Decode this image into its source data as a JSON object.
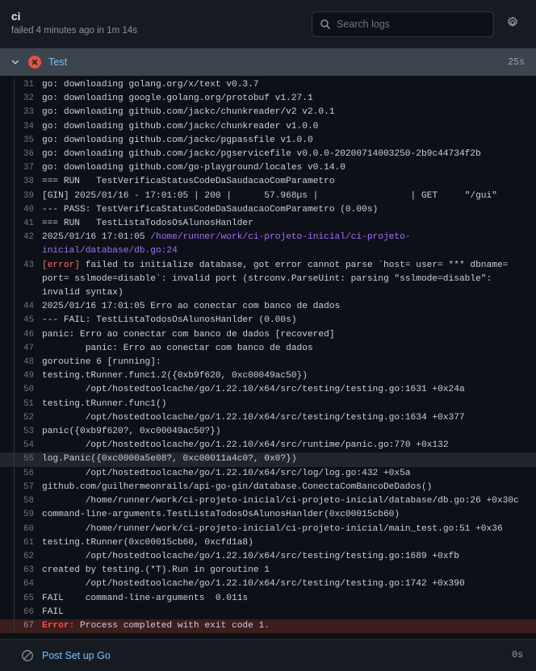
{
  "header": {
    "job_title": "ci",
    "job_status_text": "failed 4 minutes ago in 1m 14s",
    "search_placeholder": "Search logs",
    "search_value": "",
    "search_icon": "search-icon",
    "settings_icon": "gear-icon"
  },
  "step": {
    "name": "Test",
    "duration": "25s",
    "status": "failure",
    "status_icon": "x-circle-icon",
    "chevron_icon": "chevron-down-icon",
    "expanded": true
  },
  "footer_step": {
    "name": "Post Set up Go",
    "duration": "0s",
    "status": "skipped",
    "status_icon": "skip-circle-slash-icon"
  },
  "colors": {
    "page_bg": "#0d1117",
    "header_bg": "#161b22",
    "step_header_bg": "#3c444d",
    "link_blue": "#79c0ff",
    "text": "#c9d1d9",
    "muted": "#8b949e",
    "line_number": "#6e7681",
    "error_red": "#ff6b6b",
    "error_bold_red": "#f85149",
    "error_row_bg": "#3d1d1d",
    "hover_row_bg": "#21262d",
    "path_purple": "#a371f7",
    "fail_icon_bg": "#e5534b"
  },
  "log": {
    "first_line_number": 31,
    "hovered_line": 55,
    "error_line": 67,
    "lines": [
      {
        "n": 31,
        "segments": [
          {
            "t": "go: downloading golang.org/x/text v0.3.7"
          }
        ]
      },
      {
        "n": 32,
        "segments": [
          {
            "t": "go: downloading google.golang.org/protobuf v1.27.1"
          }
        ]
      },
      {
        "n": 33,
        "segments": [
          {
            "t": "go: downloading github.com/jackc/chunkreader/v2 v2.0.1"
          }
        ]
      },
      {
        "n": 34,
        "segments": [
          {
            "t": "go: downloading github.com/jackc/chunkreader v1.0.0"
          }
        ]
      },
      {
        "n": 35,
        "segments": [
          {
            "t": "go: downloading github.com/jackc/pgpassfile v1.0.0"
          }
        ]
      },
      {
        "n": 36,
        "segments": [
          {
            "t": "go: downloading github.com/jackc/pgservicefile v0.0.0-20200714003250-2b9c44734f2b"
          }
        ]
      },
      {
        "n": 37,
        "segments": [
          {
            "t": "go: downloading github.com/go-playground/locales v0.14.0"
          }
        ]
      },
      {
        "n": 38,
        "segments": [
          {
            "t": "=== RUN   TestVerificaStatusCodeDaSaudacaoComParametro"
          }
        ]
      },
      {
        "n": 39,
        "segments": [
          {
            "t": "[GIN] 2025/01/16 - 17:01:05 | 200 |      57.968µs |                 | GET     \"/gui\""
          }
        ]
      },
      {
        "n": 40,
        "segments": [
          {
            "t": "--- PASS: TestVerificaStatusCodeDaSaudacaoComParametro (0.00s)"
          }
        ]
      },
      {
        "n": 41,
        "segments": [
          {
            "t": "=== RUN   TestListaTodosOsAlunosHanlder"
          }
        ]
      },
      {
        "n": 42,
        "segments": [
          {
            "t": "2025/01/16 17:01:05 "
          },
          {
            "t": "/home/runner/work/ci-projeto-inicial/ci-projeto-inicial/database/db.go:24",
            "c": "c-purple"
          }
        ]
      },
      {
        "n": 43,
        "segments": [
          {
            "t": "[error]",
            "c": "c-red"
          },
          {
            "t": " failed to initialize database, got error cannot parse `host= user= *** dbname= port= sslmode=disable`: invalid port (strconv.ParseUint: parsing \"sslmode=disable\": invalid syntax)"
          }
        ]
      },
      {
        "n": 44,
        "segments": [
          {
            "t": "2025/01/16 17:01:05 Erro ao conectar com banco de dados"
          }
        ]
      },
      {
        "n": 45,
        "segments": [
          {
            "t": "--- FAIL: TestListaTodosOsAlunosHanlder (0.00s)"
          }
        ]
      },
      {
        "n": 46,
        "segments": [
          {
            "t": "panic: Erro ao conectar com banco de dados [recovered]"
          }
        ]
      },
      {
        "n": 47,
        "segments": [
          {
            "t": "        panic: Erro ao conectar com banco de dados"
          }
        ]
      },
      {
        "n": 48,
        "segments": [
          {
            "t": "goroutine 6 [running]:"
          }
        ]
      },
      {
        "n": 49,
        "segments": [
          {
            "t": "testing.tRunner.func1.2({0xb9f620, 0xc00049ac50})"
          }
        ]
      },
      {
        "n": 50,
        "segments": [
          {
            "t": "        /opt/hostedtoolcache/go/1.22.10/x64/src/testing/testing.go:1631 +0x24a"
          }
        ]
      },
      {
        "n": 51,
        "segments": [
          {
            "t": "testing.tRunner.func1()"
          }
        ]
      },
      {
        "n": 52,
        "segments": [
          {
            "t": "        /opt/hostedtoolcache/go/1.22.10/x64/src/testing/testing.go:1634 +0x377"
          }
        ]
      },
      {
        "n": 53,
        "segments": [
          {
            "t": "panic({0xb9f620?, 0xc00049ac50?})"
          }
        ]
      },
      {
        "n": 54,
        "segments": [
          {
            "t": "        /opt/hostedtoolcache/go/1.22.10/x64/src/runtime/panic.go:770 +0x132"
          }
        ]
      },
      {
        "n": 55,
        "segments": [
          {
            "t": "log.Panic({0xc0000a5e08?, 0xc00011a4c0?, 0x0?})"
          }
        ]
      },
      {
        "n": 56,
        "segments": [
          {
            "t": "        /opt/hostedtoolcache/go/1.22.10/x64/src/log/log.go:432 +0x5a"
          }
        ]
      },
      {
        "n": 57,
        "segments": [
          {
            "t": "github.com/guilhermeonrails/api-go-gin/database.ConectaComBancoDeDados()"
          }
        ]
      },
      {
        "n": 58,
        "segments": [
          {
            "t": "        /home/runner/work/ci-projeto-inicial/ci-projeto-inicial/database/db.go:26 +0x30c"
          }
        ]
      },
      {
        "n": 59,
        "segments": [
          {
            "t": "command-line-arguments.TestListaTodosOsAlunosHanlder(0xc00015cb60)"
          }
        ]
      },
      {
        "n": 60,
        "segments": [
          {
            "t": "        /home/runner/work/ci-projeto-inicial/ci-projeto-inicial/main_test.go:51 +0x36"
          }
        ]
      },
      {
        "n": 61,
        "segments": [
          {
            "t": "testing.tRunner(0xc00015cb60, 0xcfd1a8)"
          }
        ]
      },
      {
        "n": 62,
        "segments": [
          {
            "t": "        /opt/hostedtoolcache/go/1.22.10/x64/src/testing/testing.go:1689 +0xfb"
          }
        ]
      },
      {
        "n": 63,
        "segments": [
          {
            "t": "created by testing.(*T).Run in goroutine 1"
          }
        ]
      },
      {
        "n": 64,
        "segments": [
          {
            "t": "        /opt/hostedtoolcache/go/1.22.10/x64/src/testing/testing.go:1742 +0x390"
          }
        ]
      },
      {
        "n": 65,
        "segments": [
          {
            "t": "FAIL    command-line-arguments  0.011s"
          }
        ]
      },
      {
        "n": 66,
        "segments": [
          {
            "t": "FAIL"
          }
        ]
      },
      {
        "n": 67,
        "segments": [
          {
            "t": "Error:",
            "c": "c-redb"
          },
          {
            "t": " Process completed with exit code 1."
          }
        ]
      }
    ]
  }
}
